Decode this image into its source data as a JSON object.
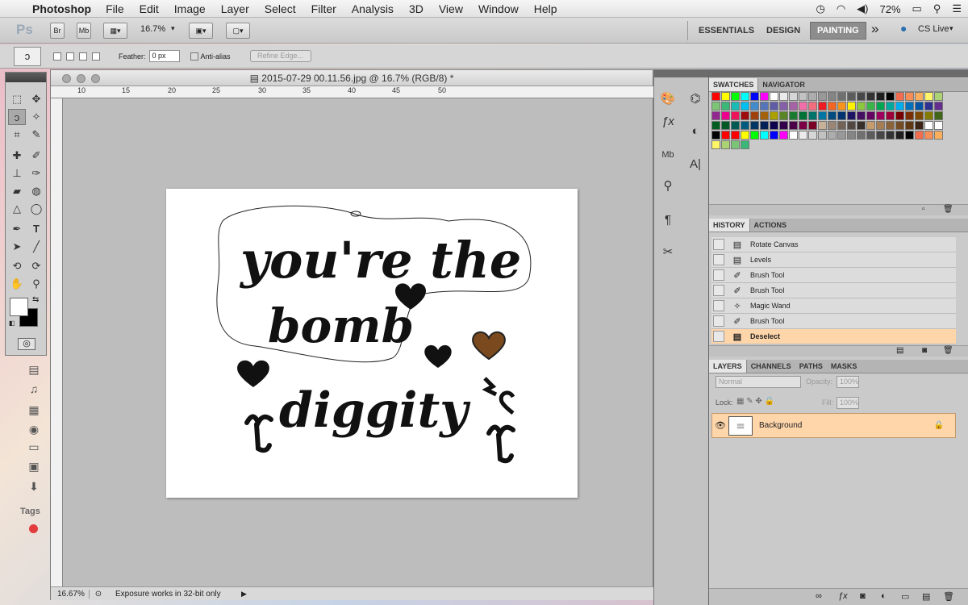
{
  "menubar": {
    "app": "Photoshop",
    "items": [
      "File",
      "Edit",
      "Image",
      "Layer",
      "Select",
      "Filter",
      "Analysis",
      "3D",
      "View",
      "Window",
      "Help"
    ],
    "battery": "72%"
  },
  "appbar": {
    "logo": "Ps",
    "br": "Br",
    "mb": "Mb",
    "zoom": "16.7%",
    "workspaces": [
      "ESSENTIALS",
      "DESIGN",
      "PAINTING"
    ],
    "active_workspace": "PAINTING",
    "more": "»",
    "cslive": "CS Live"
  },
  "options": {
    "feather_label": "Feather:",
    "feather_value": "0 px",
    "antialias_label": "Anti-alias",
    "refine_edge": "Refine Edge..."
  },
  "document": {
    "title": "2015-07-29 00.11.56.jpg @ 16.7% (RGB/8) *",
    "ruler_labels": [
      "10",
      "15",
      "20",
      "25",
      "30",
      "35",
      "40",
      "45",
      "50"
    ],
    "zoom": "16.67%",
    "status": "Exposure works in 32-bit only",
    "lettering": [
      "you're the",
      "bomb",
      "diggity"
    ]
  },
  "panels": {
    "swatch_tabs": [
      "SWATCHES",
      "NAVIGATOR"
    ],
    "history_tabs": [
      "HISTORY",
      "ACTIONS"
    ],
    "history": [
      {
        "label": "Rotate Canvas",
        "icon": "doc-icon"
      },
      {
        "label": "Levels",
        "icon": "doc-icon"
      },
      {
        "label": "Brush Tool",
        "icon": "brush-icon"
      },
      {
        "label": "Brush Tool",
        "icon": "brush-icon"
      },
      {
        "label": "Magic Wand",
        "icon": "wand-icon"
      },
      {
        "label": "Brush Tool",
        "icon": "brush-icon"
      },
      {
        "label": "Deselect",
        "icon": "doc-icon"
      }
    ],
    "layer_tabs": [
      "LAYERS",
      "CHANNELS",
      "PATHS",
      "MASKS"
    ],
    "blend_mode": "Normal",
    "opacity_label": "Opacity:",
    "opacity_value": "100%",
    "lock_label": "Lock:",
    "fill_label": "Fill:",
    "fill_value": "100%",
    "layer_name": "Background"
  },
  "desktop": {
    "tags_label": "Tags"
  },
  "colors": {
    "accent_selected": "#ffd5aa",
    "panel_bg": "#cacaca"
  }
}
